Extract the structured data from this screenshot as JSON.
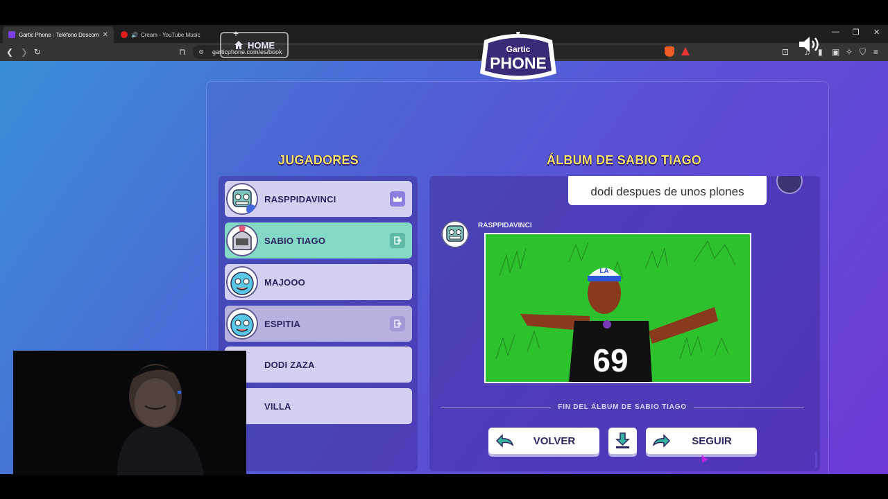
{
  "browser": {
    "tabs": [
      {
        "title": "Gartic Phone - Teléfono Descom",
        "active": true
      },
      {
        "title": "Cream - YouTube Music",
        "active": false
      }
    ],
    "url": "garticphone.com/es/book"
  },
  "header": {
    "home_label": "HOME",
    "logo_line1": "Gartic",
    "logo_line2": "PHONE"
  },
  "players": {
    "title": "JUGADORES",
    "items": [
      {
        "name": "RASPPIDAVINCI",
        "badge": "crown-icon"
      },
      {
        "name": "SABIO TIAGO",
        "badge": "exit-icon"
      },
      {
        "name": "MAJOOO",
        "badge": ""
      },
      {
        "name": "ESPITIA",
        "badge": "exit-icon"
      },
      {
        "name": "DODI ZAZA",
        "badge": ""
      },
      {
        "name": "VILLA",
        "badge": ""
      }
    ]
  },
  "album": {
    "title": "ÁLBUM DE SABIO TIAGO",
    "previous_text": "dodi despues de unos plones",
    "drawer_name": "RASPPIDAVINCI",
    "drawing_jersey_number": "69",
    "drawing_cap_text": "LA",
    "end_label": "FIN DEL ÁLBUM DE SABIO TIAGO",
    "back_label": "VOLVER",
    "next_label": "SEGUIR"
  },
  "colors": {
    "heading": "#f7e36a",
    "highlight_row": "#83d8c6",
    "drawing_bg": "#2ec12e"
  }
}
